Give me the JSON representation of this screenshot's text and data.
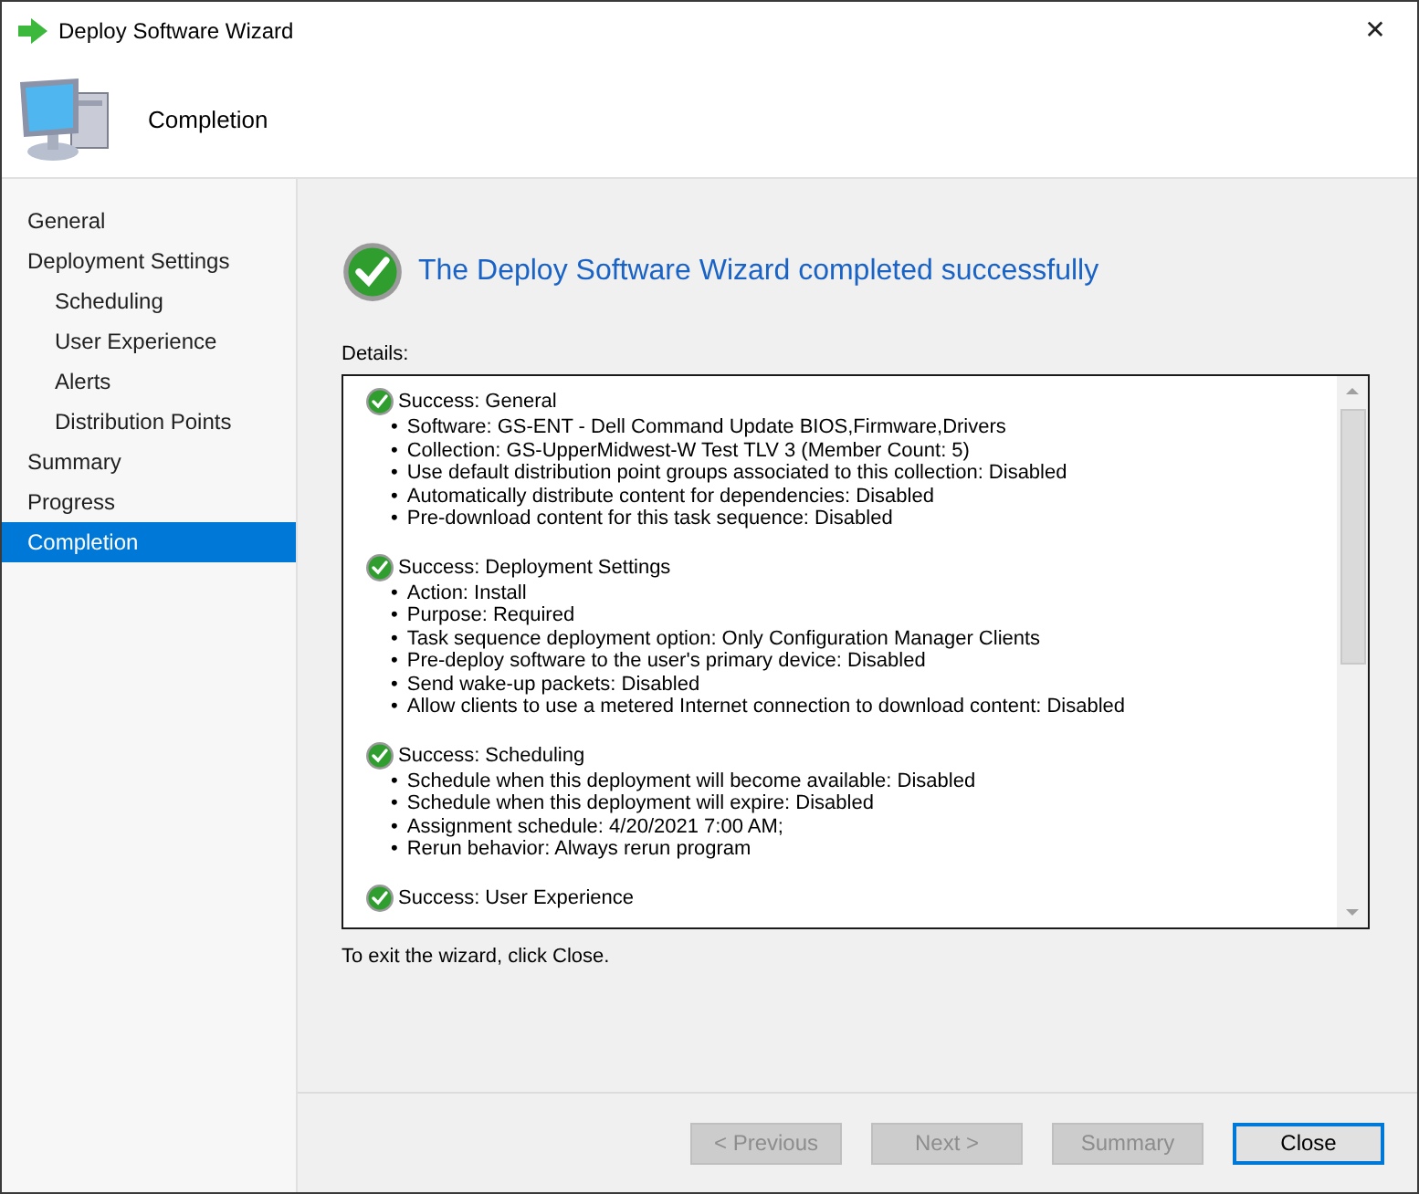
{
  "window": {
    "title": "Deploy Software Wizard",
    "close": "✕"
  },
  "header": {
    "title": "Completion"
  },
  "sidebar": {
    "items": [
      {
        "label": "General",
        "selected": false
      },
      {
        "label": "Deployment Settings",
        "selected": false,
        "children": [
          {
            "label": "Scheduling",
            "selected": false
          },
          {
            "label": "User Experience",
            "selected": false
          },
          {
            "label": "Alerts",
            "selected": false
          },
          {
            "label": "Distribution Points",
            "selected": false
          }
        ]
      },
      {
        "label": "Summary",
        "selected": false
      },
      {
        "label": "Progress",
        "selected": false
      },
      {
        "label": "Completion",
        "selected": true
      }
    ]
  },
  "result": {
    "heading": "The Deploy Software Wizard completed successfully",
    "details_label": "Details:",
    "sections": [
      {
        "title": "Success: General",
        "items": [
          "Software: GS-ENT - Dell Command Update BIOS,Firmware,Drivers",
          "Collection: GS-UpperMidwest-W Test TLV 3 (Member Count: 5)",
          "Use default distribution point groups associated to this collection: Disabled",
          "Automatically distribute content for dependencies: Disabled",
          "Pre-download content for this task sequence: Disabled"
        ]
      },
      {
        "title": "Success: Deployment Settings",
        "items": [
          "Action: Install",
          "Purpose: Required",
          "Task sequence deployment option: Only Configuration Manager Clients",
          "Pre-deploy software to the user's primary device: Disabled",
          "Send wake-up packets: Disabled",
          "Allow clients to use a metered Internet connection to download content: Disabled"
        ]
      },
      {
        "title": "Success: Scheduling",
        "items": [
          "Schedule when this deployment will become available: Disabled",
          "Schedule when this deployment will expire: Disabled",
          "Assignment schedule: 4/20/2021 7:00 AM;",
          "Rerun behavior: Always rerun program"
        ]
      },
      {
        "title": "Success: User Experience"
      }
    ],
    "bullet": "•",
    "exit_note": "To exit the wizard, click Close."
  },
  "buttons": [
    {
      "label": "< Previous",
      "disabled": true,
      "focused": false
    },
    {
      "label": "Next >",
      "disabled": true,
      "focused": false
    },
    {
      "label": "Summary",
      "disabled": true,
      "focused": false
    },
    {
      "label": "Close",
      "disabled": false,
      "focused": true
    }
  ]
}
